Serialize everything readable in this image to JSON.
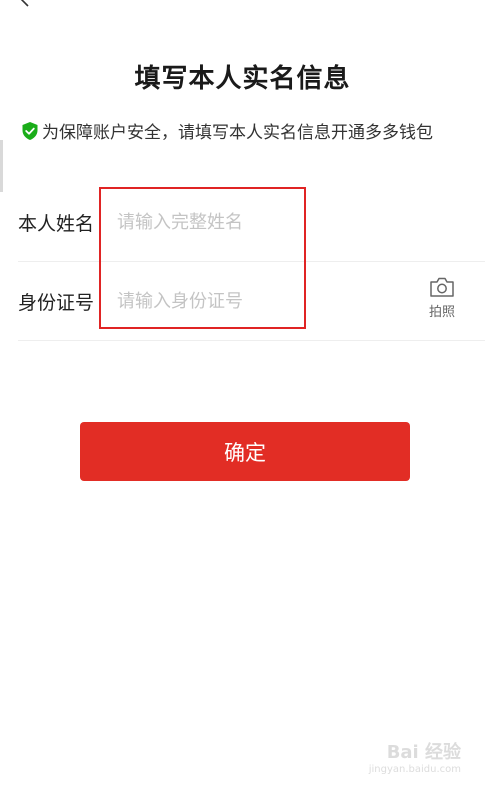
{
  "header": {
    "title": "填写本人实名信息"
  },
  "notice": {
    "text": "为保障账户安全，请填写本人实名信息开通多多钱包",
    "icon": "shield-check-icon",
    "icon_color": "#1aad19"
  },
  "form": {
    "name": {
      "label": "本人姓名",
      "value": "",
      "placeholder": "请输入完整姓名"
    },
    "id_card": {
      "label": "身份证号",
      "value": "",
      "placeholder": "请输入身份证号",
      "camera_label": "拍照"
    }
  },
  "confirm_button": {
    "label": "确定",
    "color": "#e22d25"
  },
  "watermark": {
    "main": "Bai 经验",
    "sub": "jingyan.baidu.com"
  }
}
